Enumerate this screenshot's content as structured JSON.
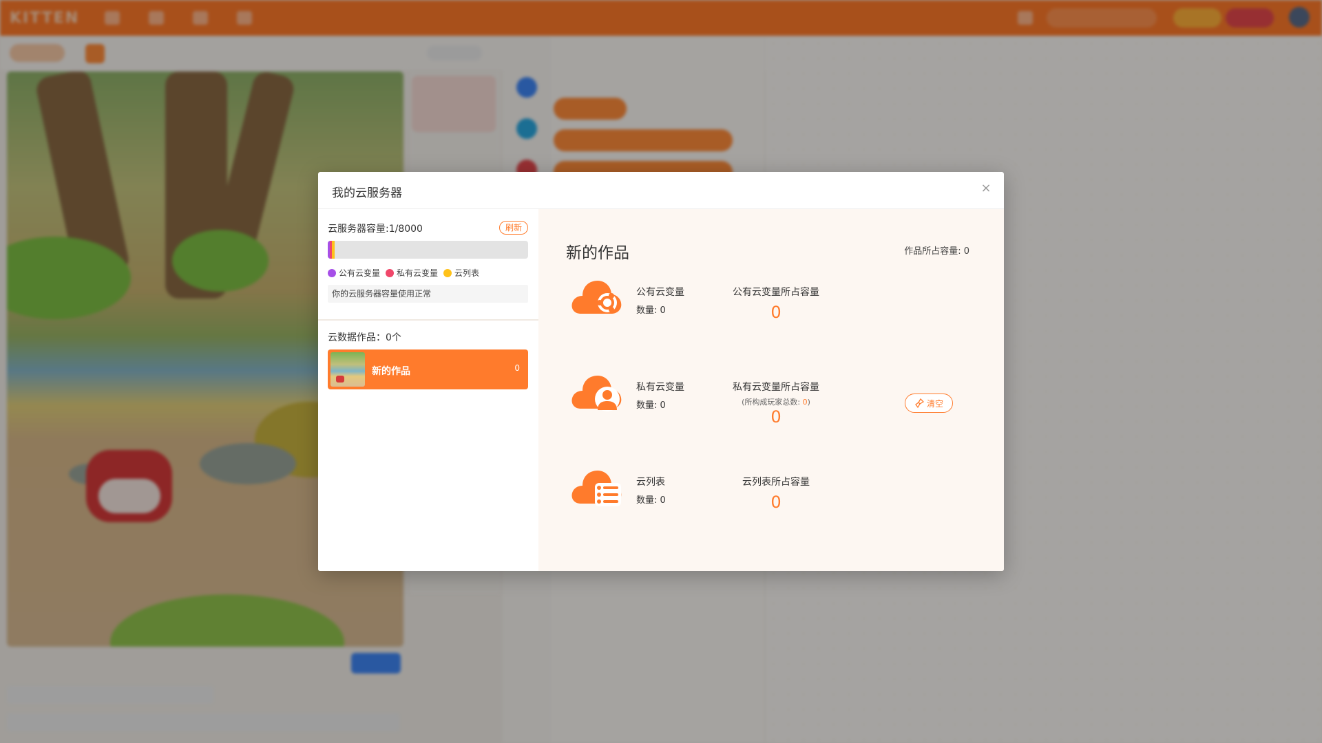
{
  "background": {
    "app_logo": "KITTEN"
  },
  "modal": {
    "title": "我的云服务器",
    "close_symbol": "×",
    "left": {
      "capacity_label": "云服务器容量:1/8000",
      "refresh_label": "刷新",
      "capacity_fraction": 0.000125,
      "legend": [
        {
          "label": "公有云变量",
          "color": "#a64fe8"
        },
        {
          "label": "私有云变量",
          "color": "#f0476a"
        },
        {
          "label": "云列表",
          "color": "#ffc21a"
        }
      ],
      "status_text": "你的云服务器容量使用正常",
      "works_label": "云数据作品：0个",
      "works": [
        {
          "name": "新的作品",
          "count": "0"
        }
      ]
    },
    "right": {
      "work_title": "新的作品",
      "work_size": "作品所占容量: 0",
      "rows": [
        {
          "icon": "cloud-share-icon",
          "name": "公有云变量",
          "count": "数量: 0",
          "cap_label": "公有云变量所占容量",
          "cap_value": "0"
        },
        {
          "icon": "cloud-user-icon",
          "name": "私有云变量",
          "count": "数量: 0",
          "cap_label": "私有云变量所占容量",
          "sub_prefix": "(所构成玩家总数: ",
          "sub_value": "0",
          "sub_suffix": ")",
          "cap_value": "0",
          "clear_label": "清空"
        },
        {
          "icon": "cloud-list-icon",
          "name": "云列表",
          "count": "数量: 0",
          "cap_label": "云列表所占容量",
          "cap_value": "0"
        }
      ]
    }
  },
  "colors": {
    "accent": "#ff7b2c",
    "public_var": "#a64fe8",
    "private_var": "#f0476a",
    "cloud_list": "#ffc21a"
  }
}
